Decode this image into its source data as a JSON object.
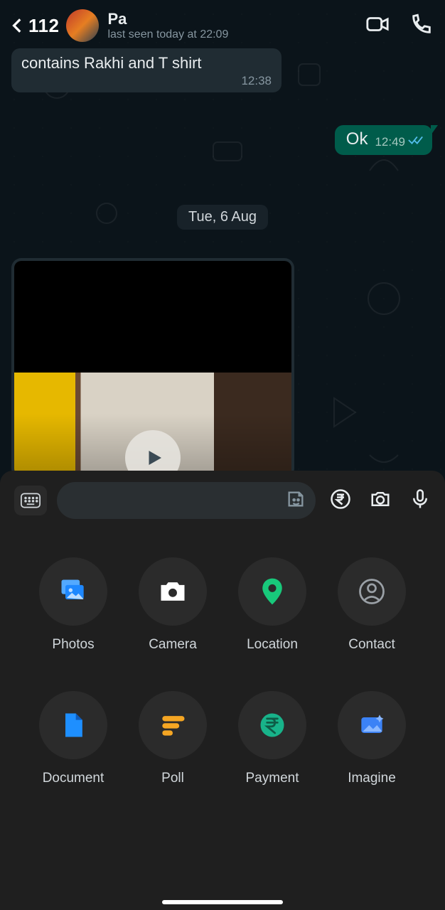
{
  "header": {
    "back_count": "112",
    "contact_name": "Pa",
    "status_line": "last seen today at 22:09"
  },
  "chat": {
    "incoming_fragment_text": "contains Rakhi and T shirt",
    "incoming_fragment_time": "12:38",
    "outgoing_text": "Ok",
    "outgoing_time": "12:49",
    "date_separator": "Tue, 6 Aug"
  },
  "attachments": {
    "options": [
      {
        "label": "Photos",
        "icon": "photos-icon",
        "color": "#2e8fff"
      },
      {
        "label": "Camera",
        "icon": "camera-icon",
        "color": "#ffffff"
      },
      {
        "label": "Location",
        "icon": "location-icon",
        "color": "#18c97b"
      },
      {
        "label": "Contact",
        "icon": "contact-icon",
        "color": "#9aa0a6"
      },
      {
        "label": "Document",
        "icon": "document-icon",
        "color": "#1e8fff"
      },
      {
        "label": "Poll",
        "icon": "poll-icon",
        "color": "#f5a623"
      },
      {
        "label": "Payment",
        "icon": "payment-icon",
        "color": "#18b38a"
      },
      {
        "label": "Imagine",
        "icon": "imagine-icon",
        "color": "#3b82f6"
      }
    ]
  }
}
